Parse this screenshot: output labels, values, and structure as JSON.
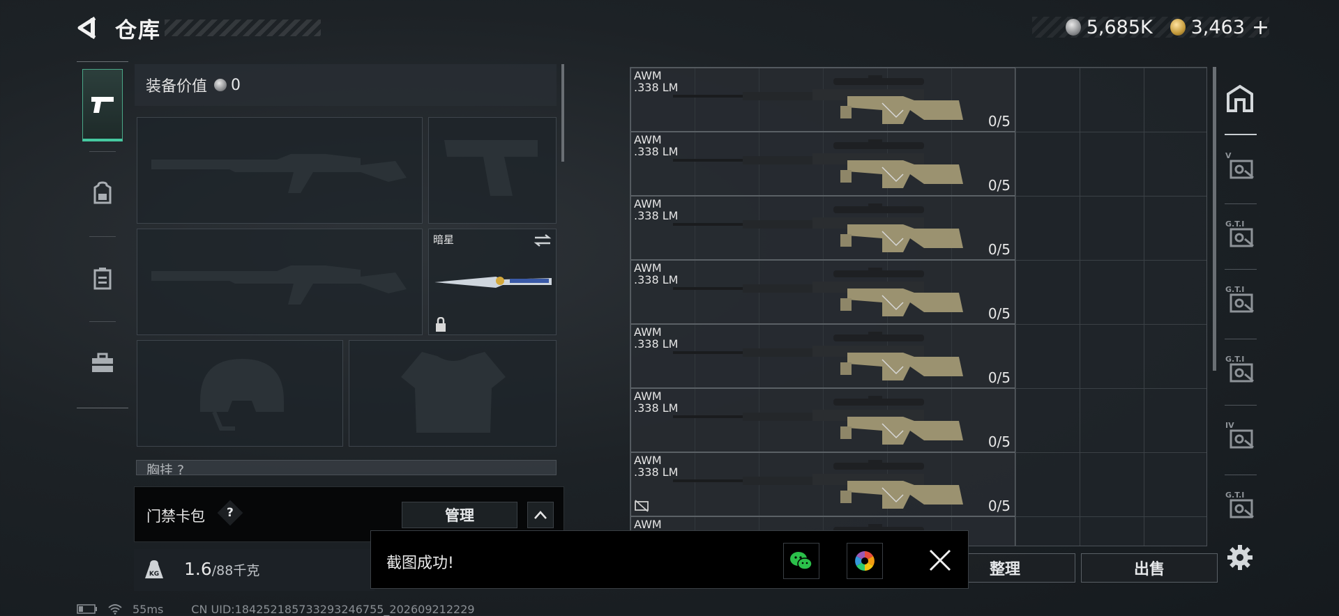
{
  "header": {
    "title": "仓库",
    "currency": {
      "silver": "5,685K",
      "gold": "3,463",
      "plus": "+"
    }
  },
  "left_nav": {
    "items": [
      {
        "icon": "pistol-icon",
        "active": true
      },
      {
        "icon": "backpack-icon",
        "active": false
      },
      {
        "icon": "container-icon",
        "active": false
      },
      {
        "icon": "briefcase-icon",
        "active": false
      }
    ]
  },
  "equipment": {
    "value_label": "装备价值",
    "value": "0",
    "melee_slot": {
      "name": "暗星"
    },
    "chest_label": "胸挂 ?"
  },
  "keycard": {
    "label": "门禁卡包",
    "help": "?",
    "manage_label": "管理"
  },
  "weight": {
    "current": "1.6",
    "max": "/88千克",
    "icon_label": "KG"
  },
  "grid_items": [
    {
      "name": "AWM",
      "ammo": ".338 LM",
      "count": "0/5"
    },
    {
      "name": "AWM",
      "ammo": ".338 LM",
      "count": "0/5"
    },
    {
      "name": "AWM",
      "ammo": ".338 LM",
      "count": "0/5"
    },
    {
      "name": "AWM",
      "ammo": ".338 LM",
      "count": "0/5"
    },
    {
      "name": "AWM",
      "ammo": ".338 LM",
      "count": "0/5"
    },
    {
      "name": "AWM",
      "ammo": ".338 LM",
      "count": "0/5"
    },
    {
      "name": "AWM",
      "ammo": ".338 LM",
      "count": "0/5"
    },
    {
      "name": "AWM",
      "ammo": "",
      "count": ""
    }
  ],
  "right_nav": {
    "items": [
      {
        "icon": "home-vault-icon"
      },
      {
        "icon": "vault-tier-5-icon",
        "label": "V"
      },
      {
        "icon": "vault-tier-3-icon",
        "label": "G.T.I"
      },
      {
        "icon": "vault-tier-3b-icon",
        "label": "G.T.I"
      },
      {
        "icon": "vault-tier-2-icon",
        "label": "G.T.I"
      },
      {
        "icon": "vault-tier-4-icon",
        "label": "IV"
      },
      {
        "icon": "vault-tier-1-icon",
        "label": "G.T.I"
      }
    ]
  },
  "actions": {
    "sort_label": "整理",
    "sell_label": "出售"
  },
  "toast": {
    "message": "截图成功!"
  },
  "status_bar": {
    "ping": "55ms",
    "uid": "CN UID:1842521857332932467​55_202609212229"
  }
}
